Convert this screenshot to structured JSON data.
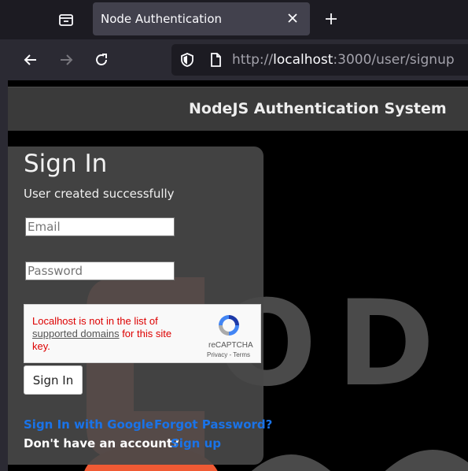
{
  "browser": {
    "tab_title": "Node Authentication",
    "url_scheme": "http://",
    "url_host": "localhost",
    "url_rest": ":3000/user/signup"
  },
  "header": {
    "title": "NodeJS Authentication System"
  },
  "background": {
    "letters": [
      "O",
      "D"
    ]
  },
  "card": {
    "title": "Sign In",
    "message": "User created successfully",
    "email_placeholder": "Email",
    "password_placeholder": "Password",
    "signin_label": "Sign In"
  },
  "recaptcha": {
    "error_prefix": "Localhost is not in the list of",
    "error_link": "supported domains",
    "error_suffix": " for this site key.",
    "brand": "reCAPTCHA",
    "privacy": "Privacy",
    "separator": " - ",
    "terms": "Terms"
  },
  "links": {
    "google": "Sign In with Google",
    "forgot": "Forgot Password?",
    "no_account": "Don't have an account?",
    "signup": "Sign up"
  },
  "colors": {
    "accent": "#1a73e8",
    "logo_orange": "#ee6a50",
    "error": "#dd0000"
  }
}
